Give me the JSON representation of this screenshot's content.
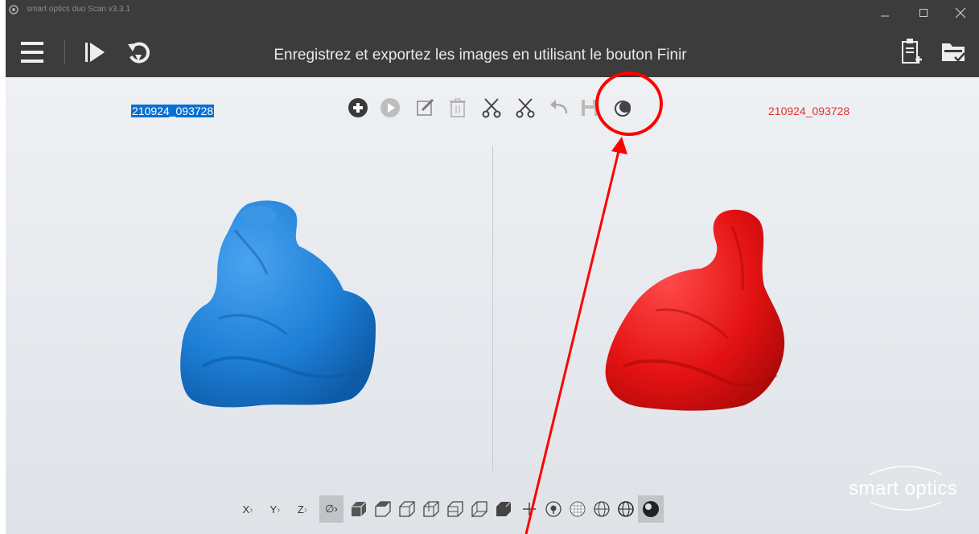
{
  "window": {
    "title": "smart optics duo Scan v3.3.1"
  },
  "toolbar": {
    "instruction": "Enregistrez et exportez les images en utilisant le bouton Finir",
    "left_icons": [
      "menu-icon",
      "play-icon",
      "reset-icon"
    ],
    "right_icons": [
      "add-document-icon",
      "folder-check-icon"
    ]
  },
  "scan": {
    "left_label": "210924_093728",
    "right_label": "210924_093728",
    "left_color": "#1e7fd6",
    "right_color": "#e31212"
  },
  "edit_tools": [
    "add-icon",
    "play-circle-icon",
    "edit-icon",
    "trash-icon",
    "cut-icon",
    "cut-inverse-icon",
    "undo-icon",
    "save-icon",
    "color-mode-icon"
  ],
  "view_tools": {
    "x_label": "X",
    "y_label": "Y",
    "z_label": "Z",
    "icons": [
      "rotate-x-icon",
      "rotate-y-icon",
      "rotate-z-icon",
      "free-rotate-icon",
      "view-front-icon",
      "view-back-icon",
      "view-left-icon",
      "view-right-icon",
      "view-top-icon",
      "view-bottom-icon",
      "view-solid-icon",
      "pan-icon",
      "point-select-icon",
      "mesh-icon",
      "wireframe-icon",
      "solid-wire-icon",
      "shaded-icon"
    ]
  },
  "logo": {
    "text": "smart optics"
  },
  "annotation": {
    "color": "#ff0000"
  }
}
